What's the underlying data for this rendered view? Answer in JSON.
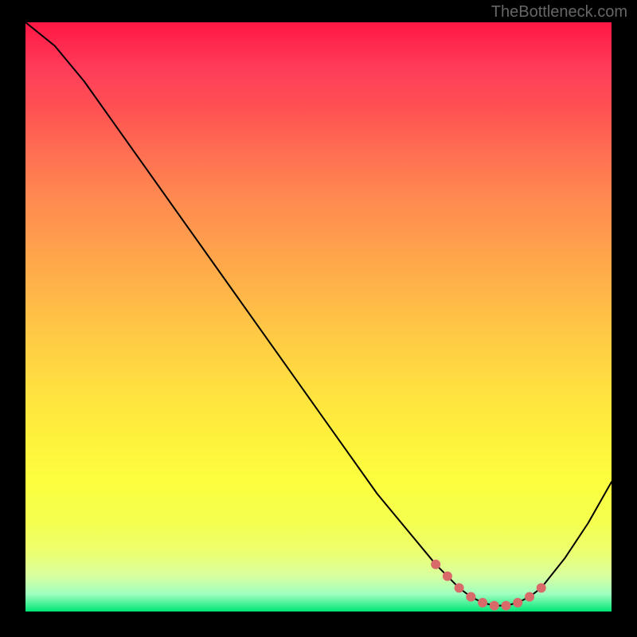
{
  "watermark": "TheBottleneck.com",
  "chart_data": {
    "type": "line",
    "title": "",
    "xlabel": "",
    "ylabel": "",
    "xlim": [
      0,
      100
    ],
    "ylim": [
      0,
      100
    ],
    "series": [
      {
        "name": "bottleneck-curve",
        "x": [
          0,
          5,
          10,
          15,
          20,
          25,
          30,
          35,
          40,
          45,
          50,
          55,
          60,
          65,
          70,
          72,
          74,
          76,
          78,
          80,
          82,
          84,
          86,
          88,
          92,
          96,
          100
        ],
        "y": [
          100,
          96,
          90,
          83,
          76,
          69,
          62,
          55,
          48,
          41,
          34,
          27,
          20,
          14,
          8,
          6,
          4,
          2.5,
          1.5,
          1,
          1,
          1.5,
          2.5,
          4,
          9,
          15,
          22
        ]
      }
    ],
    "markers": {
      "name": "optimal-range",
      "color": "#d96a6a",
      "x": [
        70,
        72,
        74,
        76,
        78,
        80,
        82,
        84,
        86,
        88
      ],
      "y": [
        8,
        6,
        4,
        2.5,
        1.5,
        1,
        1,
        1.5,
        2.5,
        4
      ]
    },
    "gradient_stops": [
      {
        "pct": 0,
        "color": "#ff1744"
      },
      {
        "pct": 50,
        "color": "#ffcc44"
      },
      {
        "pct": 85,
        "color": "#f4ff50"
      },
      {
        "pct": 100,
        "color": "#00e676"
      }
    ]
  }
}
